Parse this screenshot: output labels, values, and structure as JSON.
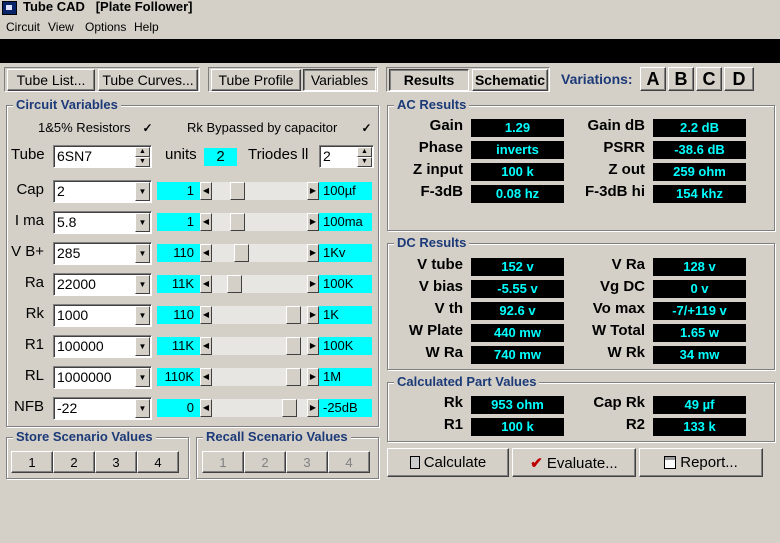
{
  "window": {
    "title": "Tube CAD   [Plate Follower]"
  },
  "menu": [
    "Circuit",
    "View",
    "Options",
    "Help"
  ],
  "toolbar": {
    "tube_list": "Tube List...",
    "tube_curves": "Tube Curves...",
    "tube_profile": "Tube Profile",
    "variables": "Variables",
    "results": "Results",
    "schematic": "Schematic",
    "variations_label": "Variations:",
    "variations": [
      "A",
      "B",
      "C",
      "D"
    ]
  },
  "circuit_variables": {
    "title": "Circuit Variables",
    "resistors_label": "1&5% Resistors",
    "resistors_checked": true,
    "rk_bypass_label": "Rk Bypassed by capacitor",
    "rk_bypass_checked": true,
    "tube_label": "Tube",
    "tube_value": "6SN7",
    "units_label": "units",
    "units_value": "2",
    "triodes_label": "Triodes ll",
    "triodes_value": "2",
    "rows": [
      {
        "label": "Cap",
        "value": "2",
        "mid": "1",
        "max": "100µf",
        "pos": 0.22
      },
      {
        "label": "I ma",
        "value": "5.8",
        "mid": "1",
        "max": "100ma",
        "pos": 0.22
      },
      {
        "label": "V B+",
        "value": "285",
        "mid": "110",
        "max": "1Kv",
        "pos": 0.27
      },
      {
        "label": "Ra",
        "value": "22000",
        "mid": "11K",
        "max": "100K",
        "pos": 0.19
      },
      {
        "label": "Rk",
        "value": "1000",
        "mid": "110",
        "max": "1K",
        "pos": 0.93
      },
      {
        "label": "R1",
        "value": "100000",
        "mid": "11K",
        "max": "100K",
        "pos": 0.93
      },
      {
        "label": "RL",
        "value": "1000000",
        "mid": "110K",
        "max": "1M",
        "pos": 0.93
      },
      {
        "label": "NFB",
        "value": "-22",
        "mid": "0",
        "max": "-25dB",
        "pos": 0.87
      }
    ]
  },
  "store": {
    "title": "Store Scenario Values",
    "buttons": [
      "1",
      "2",
      "3",
      "4"
    ]
  },
  "recall": {
    "title": "Recall Scenario Values",
    "buttons": [
      "1",
      "2",
      "3",
      "4"
    ]
  },
  "ac_results": {
    "title": "AC Results",
    "rows": [
      {
        "l1": "Gain",
        "v1": "1.29",
        "l2": "Gain dB",
        "v2": "2.2 dB"
      },
      {
        "l1": "Phase",
        "v1": "inverts",
        "l2": "PSRR",
        "v2": "-38.6 dB"
      },
      {
        "l1": "Z input",
        "v1": "100 k",
        "l2": "Z out",
        "v2": "259 ohm"
      },
      {
        "l1": "F-3dB",
        "v1": "0.08 hz",
        "l2": "F-3dB hi",
        "v2": "154 khz"
      }
    ]
  },
  "dc_results": {
    "title": "DC Results",
    "rows": [
      {
        "l1": "V tube",
        "v1": "152 v",
        "l2": "V Ra",
        "v2": "128 v"
      },
      {
        "l1": "V bias",
        "v1": "-5.55 v",
        "l2": "Vg DC",
        "v2": "0 v"
      },
      {
        "l1": "V th",
        "v1": "92.6 v",
        "l2": "Vo max",
        "v2": "-7/+119 v"
      },
      {
        "l1": "W Plate",
        "v1": "440 mw",
        "l2": "W Total",
        "v2": "1.65 w"
      },
      {
        "l1": "W Ra",
        "v1": "740 mw",
        "l2": "W Rk",
        "v2": "34 mw"
      }
    ]
  },
  "part_values": {
    "title": "Calculated Part Values",
    "rows": [
      {
        "l1": "Rk",
        "v1": "953 ohm",
        "l2": "Cap Rk",
        "v2": "49 µf"
      },
      {
        "l1": "R1",
        "v1": "100 k",
        "l2": "R2",
        "v2": "133 k"
      }
    ]
  },
  "actions": {
    "calculate": "Calculate",
    "evaluate": "Evaluate...",
    "report": "Report..."
  }
}
